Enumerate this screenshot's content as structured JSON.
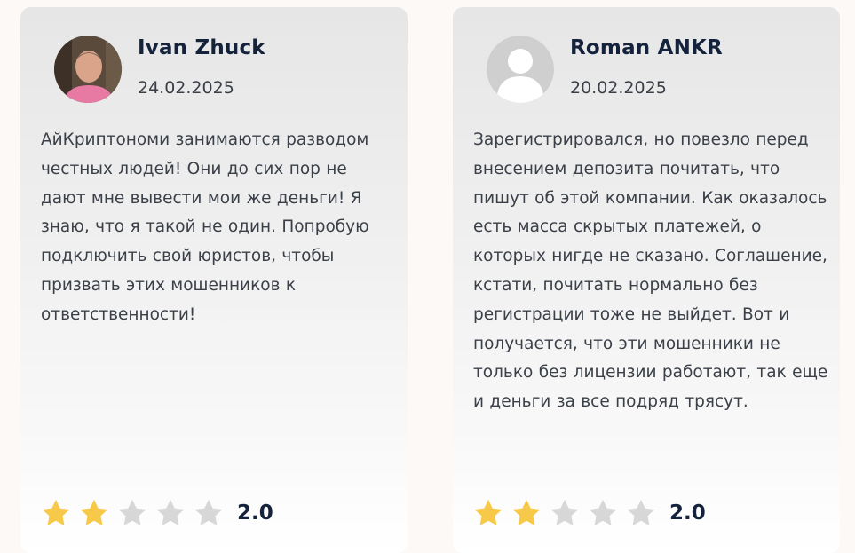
{
  "reviews": [
    {
      "name": "Ivan Zhuck",
      "date": "24.02.2025",
      "text": "АйКриптономи занимаются разводом честных людей! Они до сих пор не дают мне вывести мои же деньги! Я знаю, что я такой не один. Попробую подключить свой юристов, чтобы призвать этих мошенников к ответственности!",
      "rating": 2,
      "rating_label": "2.0",
      "avatar": "user-photo"
    },
    {
      "name": "Roman ANKR",
      "date": "20.02.2025",
      "text": "Зарегистрировался, но повезло перед внесением депозита почитать, что пишут об этой компании. Как оказалось есть масса скрытых платежей, о которых нигде не сказано. Соглашение, кстати, почитать нормально без регистрации тоже не выйдет. Вот и получается, что эти мошенники не только без лицензии работают, так еще и деньги за все подряд трясут.",
      "rating": 2,
      "rating_label": "2.0",
      "avatar": "default-user-placeholder"
    }
  ],
  "max_rating": 5,
  "colors": {
    "star_filled": "#f7c948",
    "star_empty": "#d7d7d7",
    "name": "#14233b"
  }
}
